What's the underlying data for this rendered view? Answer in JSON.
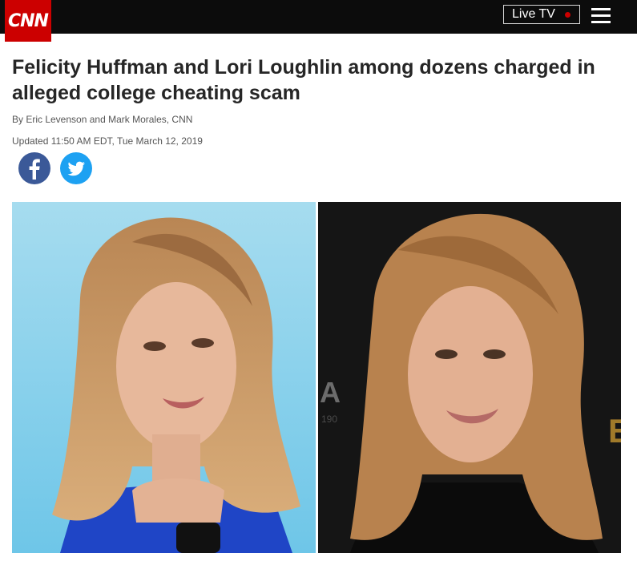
{
  "header": {
    "logo_text": "CNN",
    "live_tv_label": "Live TV",
    "brand_color": "#cc0000",
    "menu_icon": "hamburger-menu-icon"
  },
  "article": {
    "headline": "Felicity Huffman and Lori Loughlin among dozens charged in alleged college cheating scam",
    "byline": "By Eric Levenson and Mark Morales, CNN",
    "updated": "Updated 11:50 AM EDT, Tue March 12, 2019"
  },
  "share": {
    "facebook_icon": "facebook-icon",
    "twitter_icon": "twitter-icon",
    "facebook_color": "#3b5998",
    "twitter_color": "#1da1f2"
  },
  "photos": {
    "left_background": "light-blue",
    "right_background": "black"
  }
}
